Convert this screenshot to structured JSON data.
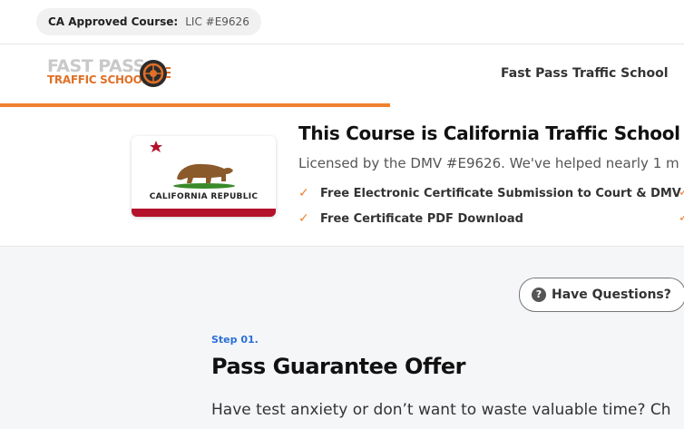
{
  "topbar": {
    "approved_label": "CA Approved Course:",
    "license": "LIC #E9626"
  },
  "header": {
    "logo_line1": "FAST PASS",
    "logo_line2": "TRAFFIC SCHOOL",
    "nav_link": "Fast Pass Traffic School"
  },
  "progress": {
    "fraction": 0.57
  },
  "banner": {
    "flag_text": "CALIFORNIA  REPUBLIC",
    "title": "This Course is California Traffic School for Ca",
    "subtitle": "Licensed by the DMV #E9626. We've helped nearly 1 m",
    "features": [
      "Free Electronic Certificate Submission to Court & DMV",
      "Free Certificate PDF Download"
    ]
  },
  "main": {
    "questions_button": "Have Questions?",
    "step_label": "Step 01.",
    "offer_title": "Pass Guarantee Offer",
    "offer_text": "Have test anxiety or don’t want to waste valuable time? Ch"
  },
  "colors": {
    "accent": "#f08030",
    "step_blue": "#2b6fd6",
    "flag_red": "#b4122a"
  }
}
